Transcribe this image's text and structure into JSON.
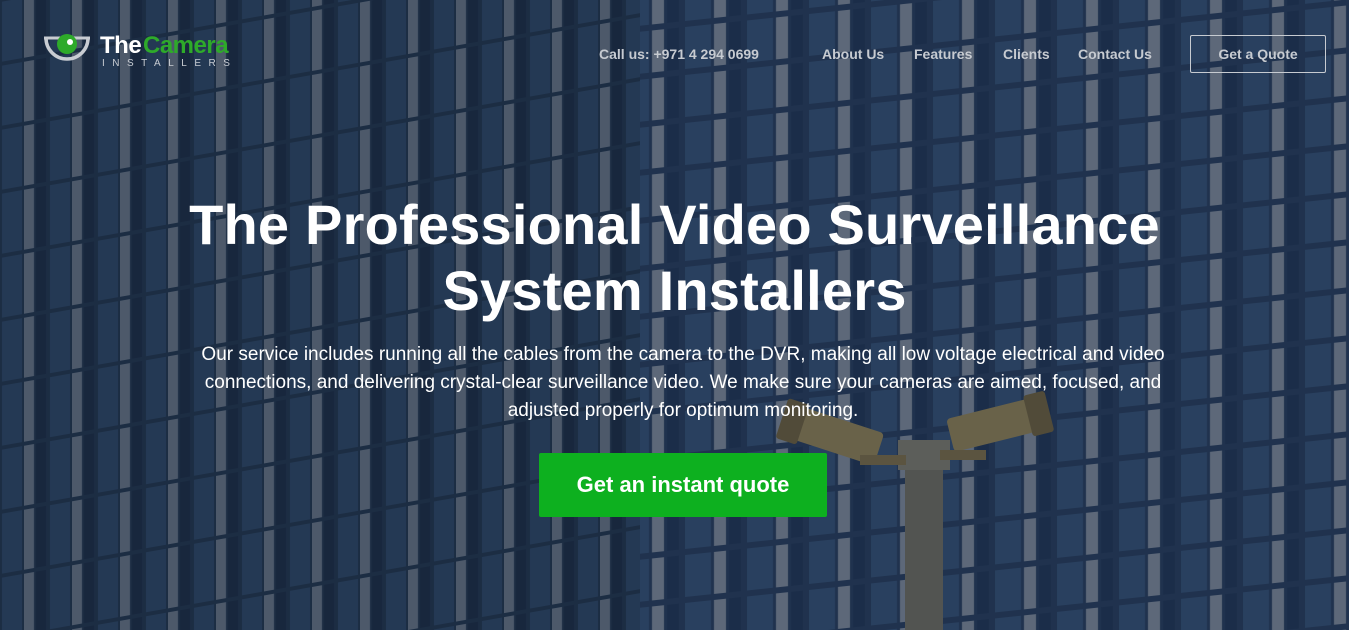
{
  "brand": {
    "name_part1": "The",
    "name_part2": "Camera",
    "tagline": "INSTALLERS",
    "accent_color": "#2eaa2a"
  },
  "nav": {
    "phone": "Call us: +971 4 294 0699",
    "items": [
      "About Us",
      "Features",
      "Clients",
      "Contact Us"
    ],
    "quote_button": "Get a Quote"
  },
  "hero": {
    "title_line1": "The Professional Video Surveillance",
    "title_line2": "System Installers",
    "description": "Our service includes running all the cables from the camera to the DVR, making all low voltage electrical and video connections, and delivering crystal-clear surveillance video. We make sure your cameras are aimed, focused, and adjusted properly for optimum monitoring.",
    "cta_label": "Get an instant quote",
    "cta_color": "#0db01f",
    "background": "glass-building-facade-with-security-cameras"
  }
}
